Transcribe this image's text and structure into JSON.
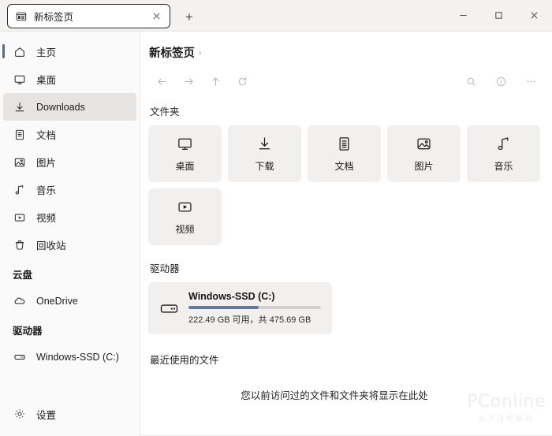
{
  "window": {
    "tab": {
      "title": "新标签页",
      "icon": "tab-page-icon",
      "close_label": "×"
    },
    "new_tab_label": "+",
    "controls": {
      "minimize": "—",
      "maximize": "□",
      "close": "✕"
    }
  },
  "sidebar": {
    "items": [
      {
        "label": "主页",
        "icon": "home-icon",
        "selected": false,
        "accent": true
      },
      {
        "label": "桌面",
        "icon": "monitor-icon",
        "selected": false,
        "accent": false
      },
      {
        "label": "Downloads",
        "icon": "download-icon",
        "selected": true,
        "accent": false
      },
      {
        "label": "文档",
        "icon": "document-icon",
        "selected": false,
        "accent": false
      },
      {
        "label": "图片",
        "icon": "picture-icon",
        "selected": false,
        "accent": false
      },
      {
        "label": "音乐",
        "icon": "music-icon",
        "selected": false,
        "accent": false
      },
      {
        "label": "视频",
        "icon": "video-icon",
        "selected": false,
        "accent": false
      },
      {
        "label": "回收站",
        "icon": "recycle-bin-icon",
        "selected": false,
        "accent": false
      }
    ],
    "cloud_section": {
      "title": "云盘",
      "items": [
        {
          "label": "OneDrive",
          "icon": "cloud-icon"
        }
      ]
    },
    "drives_section": {
      "title": "驱动器",
      "items": [
        {
          "label": "Windows-SSD (C:)",
          "icon": "drive-icon"
        }
      ]
    },
    "settings": {
      "label": "设置",
      "icon": "gear-icon"
    },
    "accent_color": "#5b6b8f",
    "selected_bg": "#e6e4e3"
  },
  "content": {
    "breadcrumb": {
      "text": "新标签页",
      "chevron": "›"
    },
    "toolbar": {
      "back": "←",
      "forward": "→",
      "up": "↑",
      "refresh": "⟳",
      "search": "search-icon",
      "info": "info-icon",
      "more": "…"
    },
    "folders_section": {
      "title": "文件夹",
      "items": [
        {
          "label": "桌面",
          "icon": "monitor-icon"
        },
        {
          "label": "下载",
          "icon": "download-icon"
        },
        {
          "label": "文档",
          "icon": "document-icon"
        },
        {
          "label": "图片",
          "icon": "picture-icon"
        },
        {
          "label": "音乐",
          "icon": "music-icon"
        },
        {
          "label": "视频",
          "icon": "video-icon"
        }
      ]
    },
    "drives_section": {
      "title": "驱动器",
      "drive": {
        "name": "Windows-SSD (C:)",
        "usage_text": "222.49 GB 可用，共 475.69 GB",
        "free_gb": 222.49,
        "total_gb": 475.69,
        "used_percent": 53,
        "bar_fill_color": "#64769c",
        "bar_track_color": "#d3d1cf"
      }
    },
    "recent_section": {
      "title": "最近使用的文件",
      "empty_text": "您以前访问过的文件和文件夹将显示在此处"
    }
  },
  "watermark": {
    "main": "PConline",
    "sub": "太平洋电脑网"
  }
}
